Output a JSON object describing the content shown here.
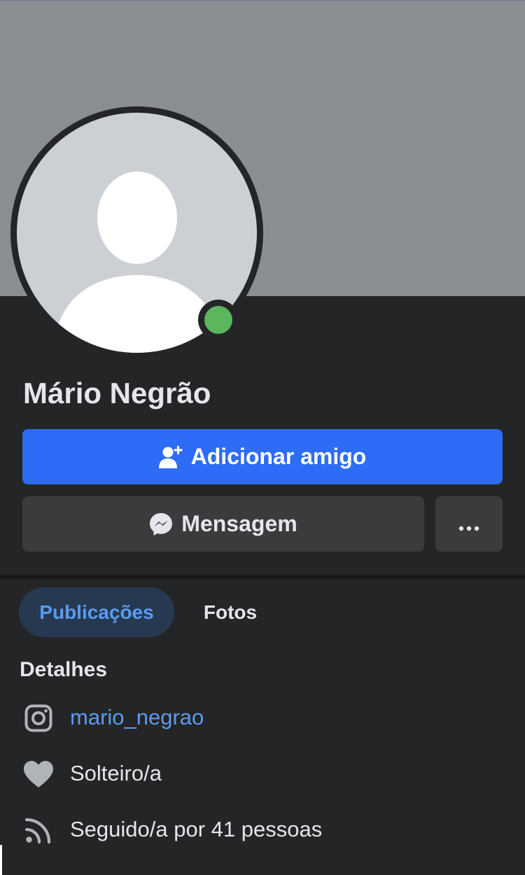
{
  "profile": {
    "name": "Mário Negrão",
    "online": true,
    "status_color": "#5ab75d"
  },
  "actions": {
    "add_friend_label": "Adicionar amigo",
    "add_friend_icon": "add-friend-icon",
    "message_label": "Mensagem",
    "message_icon": "messenger-icon",
    "more_icon": "more-dots-icon"
  },
  "tabs": [
    {
      "label": "Publicações",
      "active": true
    },
    {
      "label": "Fotos",
      "active": false
    }
  ],
  "details": {
    "title": "Detalhes",
    "items": [
      {
        "icon": "instagram-icon",
        "text": "mario_negrao",
        "is_link": true
      },
      {
        "icon": "heart-icon",
        "text": "Solteiro/a",
        "is_link": false
      },
      {
        "icon": "followers-icon",
        "text": "Seguido/a por 41 pessoas",
        "is_link": false
      }
    ]
  },
  "colors": {
    "accent": "#2d6cf6",
    "link": "#5b9bf0",
    "background": "#242526",
    "cover": "#8a8d91"
  }
}
